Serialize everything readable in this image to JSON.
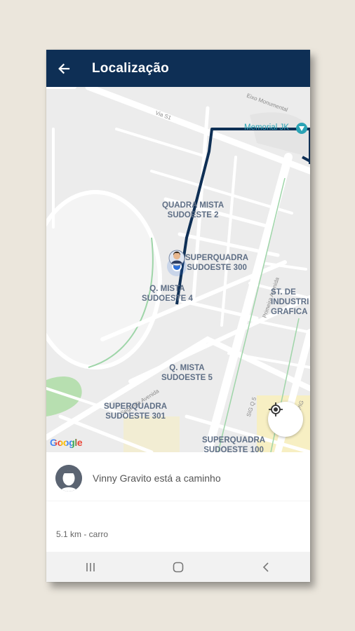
{
  "app": {
    "title": "Localização"
  },
  "map": {
    "labels": {
      "quadra_mista_2": "QUADRA MISTA\nSUDOESTE 2",
      "superquadra_300": "SUPERQUADRA\nSUDOESTE 300",
      "q_mista_4": "Q. MISTA\nSUDOESTE 4",
      "st_industrias": "ST. DE\nINDUSTRI\nGRAFICA",
      "q_mista_5": "Q. MISTA\nSUDOESTE 5",
      "superquadra_301": "SUPERQUADRA\nSUDOESTE 301",
      "superquadra_100": "SUPERQUADRA\nSUDOESTE 100"
    },
    "streets": {
      "eixo_monumental": "Eixo Monumental",
      "via_s1": "Via S1",
      "segunda_avenida": "Segunda Avenida",
      "primeira_avenida": "Primeira Avenida",
      "sig_q5": "SIG Q 5",
      "epig": "EPIG"
    },
    "poi": "Memorial JK",
    "attribution": "Google",
    "route_color": "#0e2f55",
    "icons": {
      "locate": "my-location-icon",
      "driver": "driver-avatar-icon"
    }
  },
  "sheet": {
    "driver_status": "Vinny Gravito está a caminho",
    "distance": "5.1 km - carro"
  },
  "navbar": {
    "icons": [
      "recent-apps-icon",
      "home-icon",
      "back-nav-icon"
    ]
  }
}
